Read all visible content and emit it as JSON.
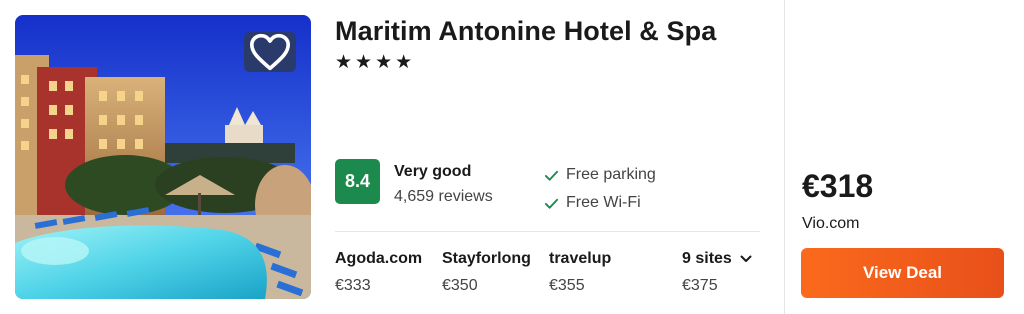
{
  "hotel": {
    "name": "Maritim Antonine Hotel & Spa",
    "stars": "★★★★",
    "favorite_icon": "heart-outline-icon"
  },
  "rating": {
    "score": "8.4",
    "label": "Very good",
    "reviews": "4,659 reviews",
    "badge_color": "#1b8a4c"
  },
  "amenities": [
    {
      "label": "Free parking",
      "icon": "check-icon"
    },
    {
      "label": "Free Wi-Fi",
      "icon": "check-icon"
    }
  ],
  "sites": [
    {
      "name": "Agoda.com",
      "price": "€333"
    },
    {
      "name": "Stayforlong",
      "price": "€350"
    },
    {
      "name": "travelup",
      "price": "€355"
    }
  ],
  "more_sites": {
    "label": "9 sites",
    "price": "€375",
    "icon": "chevron-down-icon"
  },
  "deal": {
    "price": "€318",
    "site": "Vio.com",
    "button_label": "View Deal",
    "button_color": "#f45d1b"
  }
}
